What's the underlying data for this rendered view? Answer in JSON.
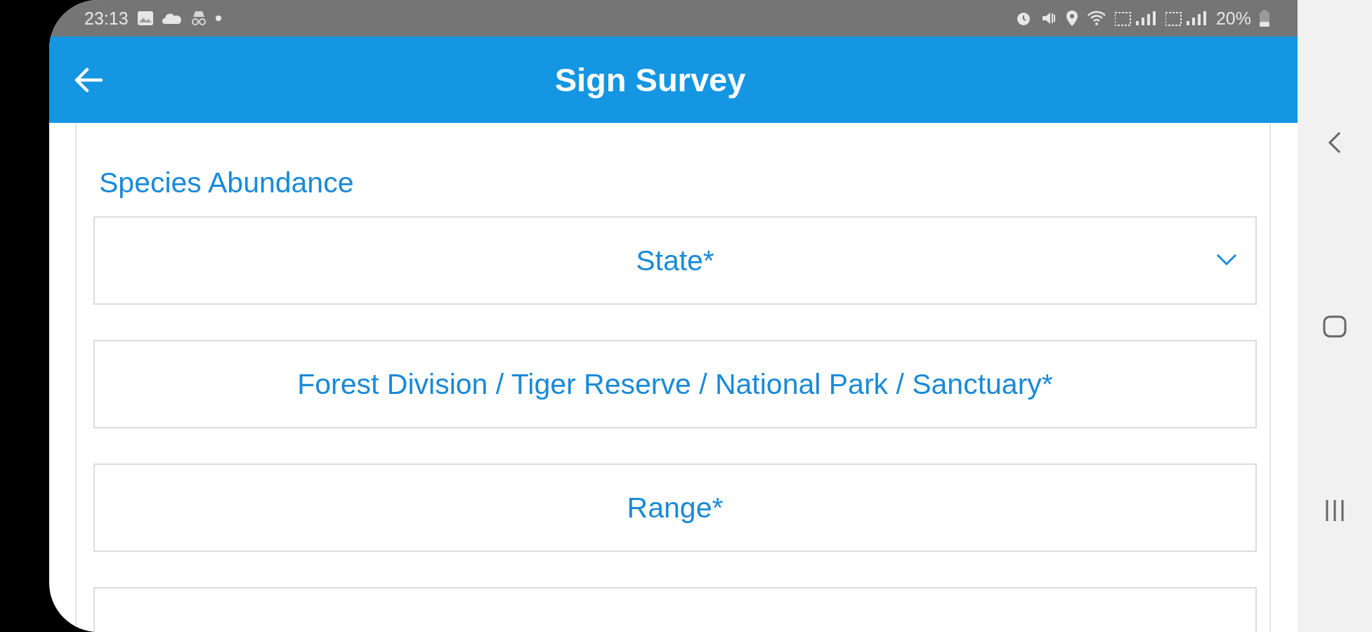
{
  "status_bar": {
    "time": "23:13",
    "battery": "20%"
  },
  "app_bar": {
    "title": "Sign Survey"
  },
  "form": {
    "heading": "Species Abundance",
    "fields": [
      {
        "label": "State*",
        "kind": "dropdown"
      },
      {
        "label": "Forest Division / Tiger Reserve / National Park / Sanctuary*",
        "kind": "picker"
      },
      {
        "label": "Range*",
        "kind": "picker"
      },
      {
        "kind": "picker"
      }
    ]
  }
}
